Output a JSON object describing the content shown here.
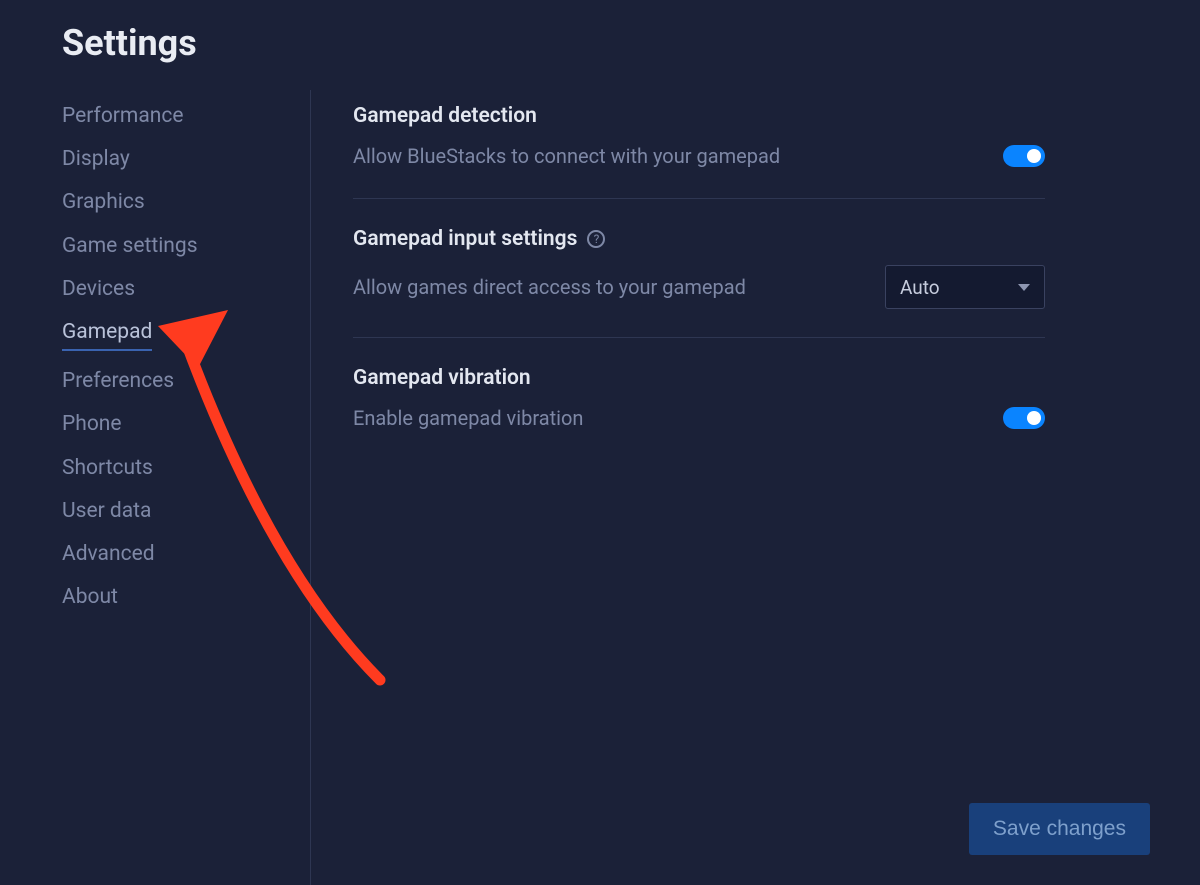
{
  "page_title": "Settings",
  "sidebar": {
    "items": [
      {
        "label": "Performance",
        "active": false
      },
      {
        "label": "Display",
        "active": false
      },
      {
        "label": "Graphics",
        "active": false
      },
      {
        "label": "Game settings",
        "active": false
      },
      {
        "label": "Devices",
        "active": false
      },
      {
        "label": "Gamepad",
        "active": true
      },
      {
        "label": "Preferences",
        "active": false
      },
      {
        "label": "Phone",
        "active": false
      },
      {
        "label": "Shortcuts",
        "active": false
      },
      {
        "label": "User data",
        "active": false
      },
      {
        "label": "Advanced",
        "active": false
      },
      {
        "label": "About",
        "active": false
      }
    ]
  },
  "content": {
    "sections": [
      {
        "title": "Gamepad detection",
        "desc": "Allow BlueStacks to connect with your gamepad",
        "control": "toggle",
        "value": true
      },
      {
        "title": "Gamepad input settings",
        "help": true,
        "desc": "Allow games direct access to your gamepad",
        "control": "select",
        "value": "Auto"
      },
      {
        "title": "Gamepad vibration",
        "desc": "Enable gamepad vibration",
        "control": "toggle",
        "value": true
      }
    ]
  },
  "footer": {
    "save_label": "Save changes"
  },
  "annotation": {
    "arrow_color": "#ff3b1f",
    "target": "Gamepad"
  }
}
